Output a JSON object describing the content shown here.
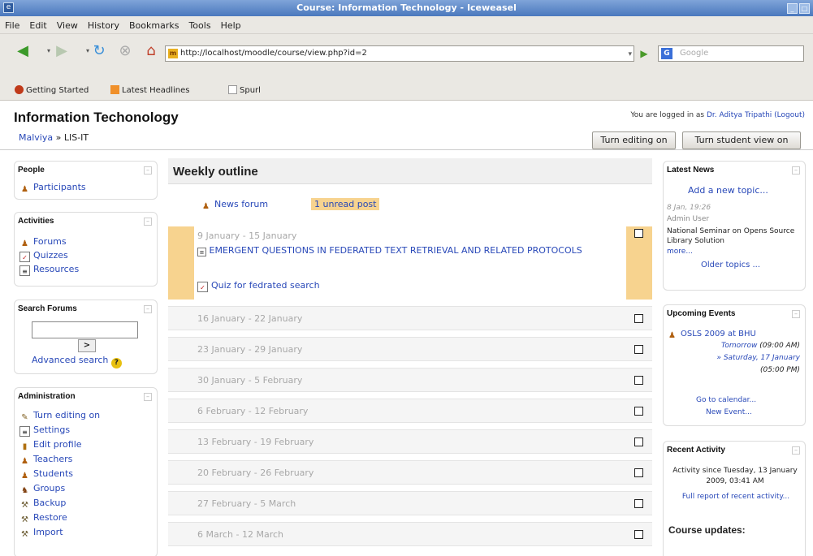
{
  "window": {
    "title": "Course: Information Technology - Iceweasel"
  },
  "menu": [
    "File",
    "Edit",
    "View",
    "History",
    "Bookmarks",
    "Tools",
    "Help"
  ],
  "nav": {
    "url": "http://localhost/moodle/course/view.php?id=2",
    "search_placeholder": "Google"
  },
  "bookmarks": [
    "Getting Started",
    "Latest Headlines",
    "Spurl"
  ],
  "site": {
    "title": "Information Techonology",
    "login_prefix": "You are logged in as",
    "user": "Dr. Aditya Tripathi",
    "logout": "(Logout)"
  },
  "breadcrumb": {
    "home": "Malviya",
    "sep": "»",
    "current": "LIS-IT"
  },
  "buttons": {
    "editing": "Turn editing on",
    "student_view": "Turn student view on"
  },
  "people": {
    "title": "People",
    "items": [
      "Participants"
    ]
  },
  "activities": {
    "title": "Activities",
    "items": [
      "Forums",
      "Quizzes",
      "Resources"
    ]
  },
  "search_forums": {
    "title": "Search Forums",
    "go": ">",
    "advanced": "Advanced search"
  },
  "administration": {
    "title": "Administration",
    "items": [
      "Turn editing on",
      "Settings",
      "Edit profile",
      "Teachers",
      "Students",
      "Groups",
      "Backup",
      "Restore",
      "Import"
    ]
  },
  "outline": {
    "title": "Weekly outline",
    "news_forum": "News forum",
    "unread": "1 unread post",
    "current_week": {
      "date": "9 January - 15 January",
      "resource": "EMERGENT QUESTIONS IN FEDERATED TEXT RETRIEVAL AND RELATED PROTOCOLS",
      "quiz": "Quiz for fedrated search"
    },
    "weeks": [
      "16 January - 22 January",
      "23 January - 29 January",
      "30 January - 5 February",
      "6 February - 12 February",
      "13 February - 19 February",
      "20 February - 26 February",
      "27 February - 5 March",
      "6 March - 12 March"
    ]
  },
  "latest_news": {
    "title": "Latest News",
    "add": "Add a new topic...",
    "date": "8 Jan, 19:26",
    "author": "Admin User",
    "text": "National Seminar on Opens Source Library Solution",
    "more": "more...",
    "older": "Older topics ..."
  },
  "events": {
    "title": "Upcoming Events",
    "event": "OSLS 2009 at BHU",
    "when1": "Tomorrow",
    "time1": "(09:00 AM)",
    "when2": "» Saturday, 17 January",
    "time2": "(05:00 PM)",
    "calendar": "Go to calendar...",
    "new": "New Event..."
  },
  "recent": {
    "title": "Recent Activity",
    "since": "Activity since Tuesday, 13 January 2009, 03:41 AM",
    "report": "Full report of recent activity...",
    "updates": "Course updates:"
  }
}
